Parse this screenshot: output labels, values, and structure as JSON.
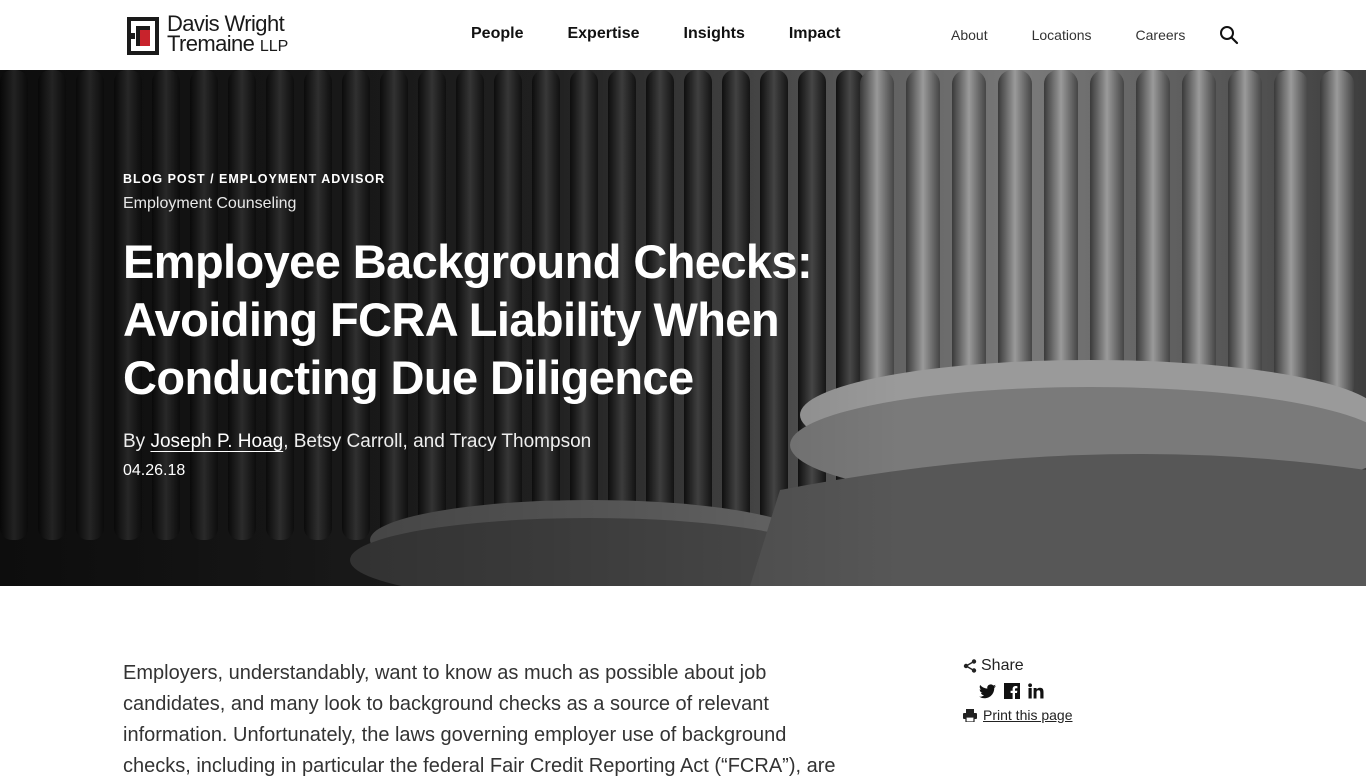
{
  "header": {
    "logo": {
      "line1": "Davis Wright",
      "line2": "Tremaine",
      "suffix": "LLP"
    },
    "primary_nav": [
      "People",
      "Expertise",
      "Insights",
      "Impact"
    ],
    "utility_nav": [
      "About",
      "Locations",
      "Careers"
    ],
    "search_icon": "search-icon"
  },
  "hero": {
    "eyebrow": "BLOG POST / EMPLOYMENT ADVISOR",
    "category": "Employment Counseling",
    "title": "Employee Background Checks: Avoiding FCRA Liability When Conducting Due Diligence",
    "byline_prefix": "By ",
    "author_link": "Joseph P. Hoag",
    "byline_rest": ", Betsy Carroll, and Tracy Thompson",
    "date": "04.26.18"
  },
  "article": {
    "paragraph": "Employers, understandably, want to know as much as possible about job candidates, and many look to background checks as a source of relevant information. Unfortunately, the laws governing employer use of background checks, including in particular the federal Fair Credit Reporting Act (“FCRA”), are"
  },
  "sidebar": {
    "share_label": "Share",
    "social_icons": [
      "twitter-icon",
      "facebook-icon",
      "linkedin-icon"
    ],
    "print_label": "Print this page"
  },
  "colors": {
    "logo_red": "#c8232c",
    "hero_text": "#ffffff"
  }
}
